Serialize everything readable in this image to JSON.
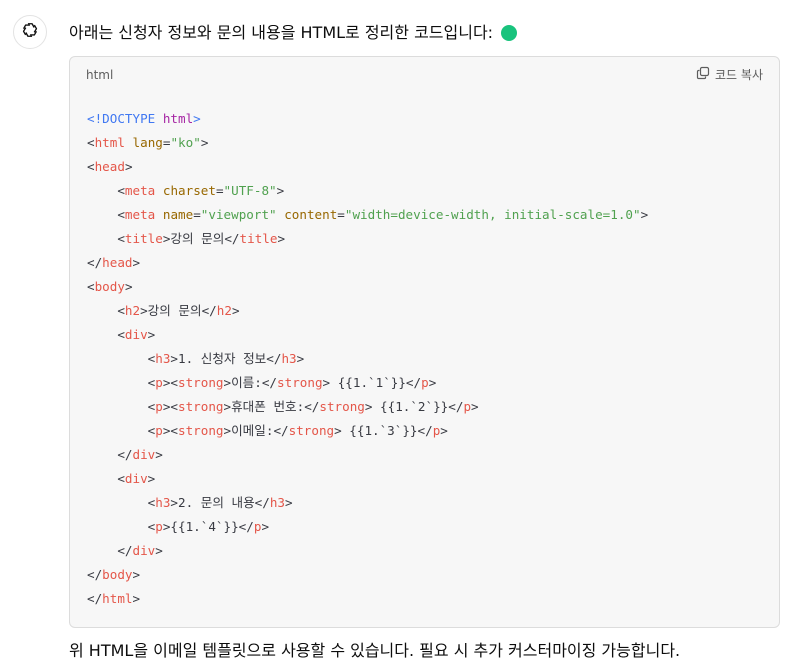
{
  "message": {
    "intro_text": "아래는 신청자 정보와 문의 내용을 HTML로 정리한 코드입니다:",
    "status_color": "#19c37d",
    "avatar_icon": "openai-logo-icon",
    "footer_text": "위 HTML을 이메일 템플릿으로 사용할 수 있습니다. 필요 시 추가 커스터마이징 가능합니다."
  },
  "code_block": {
    "language": "html",
    "copy_label": "코드 복사",
    "copy_icon": "copy-icon",
    "lines": [
      [
        [
          "meta",
          "<!DOCTYPE "
        ],
        [
          "kw",
          "html"
        ],
        [
          "meta",
          ">"
        ]
      ],
      [
        [
          "txt",
          "<"
        ],
        [
          "tag",
          "html"
        ],
        [
          "txt",
          " "
        ],
        [
          "attr",
          "lang"
        ],
        [
          "txt",
          "="
        ],
        [
          "str",
          "\"ko\""
        ],
        [
          "txt",
          ">"
        ]
      ],
      [
        [
          "txt",
          "<"
        ],
        [
          "tag",
          "head"
        ],
        [
          "txt",
          ">"
        ]
      ],
      [
        [
          "txt",
          "    <"
        ],
        [
          "tag",
          "meta"
        ],
        [
          "txt",
          " "
        ],
        [
          "attr",
          "charset"
        ],
        [
          "txt",
          "="
        ],
        [
          "str",
          "\"UTF-8\""
        ],
        [
          "txt",
          ">"
        ]
      ],
      [
        [
          "txt",
          "    <"
        ],
        [
          "tag",
          "meta"
        ],
        [
          "txt",
          " "
        ],
        [
          "attr",
          "name"
        ],
        [
          "txt",
          "="
        ],
        [
          "str",
          "\"viewport\""
        ],
        [
          "txt",
          " "
        ],
        [
          "attr",
          "content"
        ],
        [
          "txt",
          "="
        ],
        [
          "str",
          "\"width=device-width, initial-scale=1.0\""
        ],
        [
          "txt",
          ">"
        ]
      ],
      [
        [
          "txt",
          "    <"
        ],
        [
          "tag",
          "title"
        ],
        [
          "txt",
          ">강의 문의</"
        ],
        [
          "tag",
          "title"
        ],
        [
          "txt",
          ">"
        ]
      ],
      [
        [
          "txt",
          "</"
        ],
        [
          "tag",
          "head"
        ],
        [
          "txt",
          ">"
        ]
      ],
      [
        [
          "txt",
          "<"
        ],
        [
          "tag",
          "body"
        ],
        [
          "txt",
          ">"
        ]
      ],
      [
        [
          "txt",
          "    <"
        ],
        [
          "tag",
          "h2"
        ],
        [
          "txt",
          ">강의 문의</"
        ],
        [
          "tag",
          "h2"
        ],
        [
          "txt",
          ">"
        ]
      ],
      [
        [
          "txt",
          "    <"
        ],
        [
          "tag",
          "div"
        ],
        [
          "txt",
          ">"
        ]
      ],
      [
        [
          "txt",
          "        <"
        ],
        [
          "tag",
          "h3"
        ],
        [
          "txt",
          ">1. 신청자 정보</"
        ],
        [
          "tag",
          "h3"
        ],
        [
          "txt",
          ">"
        ]
      ],
      [
        [
          "txt",
          "        <"
        ],
        [
          "tag",
          "p"
        ],
        [
          "txt",
          "><"
        ],
        [
          "tag",
          "strong"
        ],
        [
          "txt",
          ">이름:</"
        ],
        [
          "tag",
          "strong"
        ],
        [
          "txt",
          "> {{1.`1`}}</"
        ],
        [
          "tag",
          "p"
        ],
        [
          "txt",
          ">"
        ]
      ],
      [
        [
          "txt",
          "        <"
        ],
        [
          "tag",
          "p"
        ],
        [
          "txt",
          "><"
        ],
        [
          "tag",
          "strong"
        ],
        [
          "txt",
          ">휴대폰 번호:</"
        ],
        [
          "tag",
          "strong"
        ],
        [
          "txt",
          "> {{1.`2`}}</"
        ],
        [
          "tag",
          "p"
        ],
        [
          "txt",
          ">"
        ]
      ],
      [
        [
          "txt",
          "        <"
        ],
        [
          "tag",
          "p"
        ],
        [
          "txt",
          "><"
        ],
        [
          "tag",
          "strong"
        ],
        [
          "txt",
          ">이메일:</"
        ],
        [
          "tag",
          "strong"
        ],
        [
          "txt",
          "> {{1.`3`}}</"
        ],
        [
          "tag",
          "p"
        ],
        [
          "txt",
          ">"
        ]
      ],
      [
        [
          "txt",
          "    </"
        ],
        [
          "tag",
          "div"
        ],
        [
          "txt",
          ">"
        ]
      ],
      [
        [
          "txt",
          "    <"
        ],
        [
          "tag",
          "div"
        ],
        [
          "txt",
          ">"
        ]
      ],
      [
        [
          "txt",
          "        <"
        ],
        [
          "tag",
          "h3"
        ],
        [
          "txt",
          ">2. 문의 내용</"
        ],
        [
          "tag",
          "h3"
        ],
        [
          "txt",
          ">"
        ]
      ],
      [
        [
          "txt",
          "        <"
        ],
        [
          "tag",
          "p"
        ],
        [
          "txt",
          ">{{1.`4`}}</"
        ],
        [
          "tag",
          "p"
        ],
        [
          "txt",
          ">"
        ]
      ],
      [
        [
          "txt",
          "    </"
        ],
        [
          "tag",
          "div"
        ],
        [
          "txt",
          ">"
        ]
      ],
      [
        [
          "txt",
          "</"
        ],
        [
          "tag",
          "body"
        ],
        [
          "txt",
          ">"
        ]
      ],
      [
        [
          "txt",
          "</"
        ],
        [
          "tag",
          "html"
        ],
        [
          "txt",
          ">"
        ]
      ]
    ]
  }
}
